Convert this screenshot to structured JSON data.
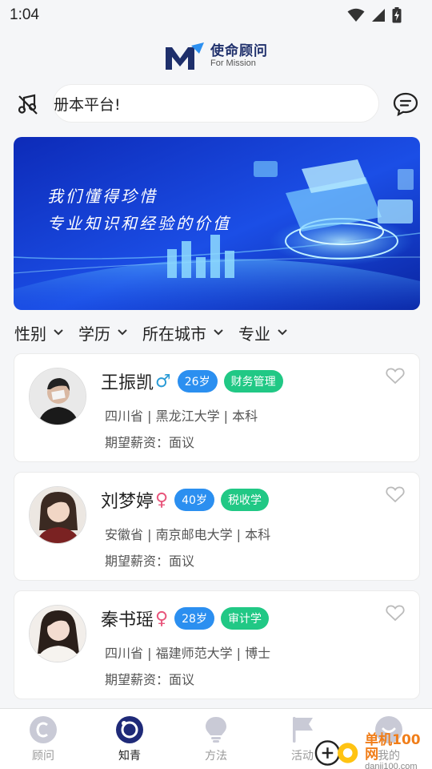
{
  "status": {
    "time": "1:04"
  },
  "brand": {
    "name_cn": "使命顾问",
    "name_en": "For Mission",
    "logo": "m-logo-icon"
  },
  "notice": {
    "text": "册本平台!"
  },
  "banner": {
    "line1": "我们懂得珍惜",
    "line2": "专业知识和经验的价值"
  },
  "filters": [
    {
      "label": "性别"
    },
    {
      "label": "学历"
    },
    {
      "label": "所在城市"
    },
    {
      "label": "专业"
    }
  ],
  "cards": [
    {
      "name": "王振凯",
      "gender": "male",
      "gender_symbol": "♂",
      "age": "26岁",
      "major": "财务管理",
      "info": "四川省 | 黑龙江大学 | 本科",
      "salary": "期望薪资：面议"
    },
    {
      "name": "刘梦婷",
      "gender": "female",
      "gender_symbol": "♀",
      "age": "40岁",
      "major": "税收学",
      "info": "安徽省 | 南京邮电大学 | 本科",
      "salary": "期望薪资：面议"
    },
    {
      "name": "秦书瑶",
      "gender": "female",
      "gender_symbol": "♀",
      "age": "28岁",
      "major": "审计学",
      "info": "四川省 | 福建师范大学 | 博士",
      "salary": "期望薪资：面议"
    }
  ],
  "tabs": [
    {
      "label": "顾问",
      "icon": "c-circle-icon",
      "active": false
    },
    {
      "label": "知青",
      "icon": "ring-icon",
      "active": true
    },
    {
      "label": "方法",
      "icon": "lightbulb-icon",
      "active": false
    },
    {
      "label": "活动",
      "icon": "flag-icon",
      "active": false
    },
    {
      "label": "我的",
      "icon": "user-icon",
      "active": false
    }
  ],
  "watermark": {
    "text": "单机100网",
    "url": "danji100.com"
  },
  "colors": {
    "brand": "#1e2f6b",
    "age_badge": "#2b8ff0",
    "major_badge": "#21c885",
    "female": "#e8557b",
    "male": "#2a9bd6"
  }
}
